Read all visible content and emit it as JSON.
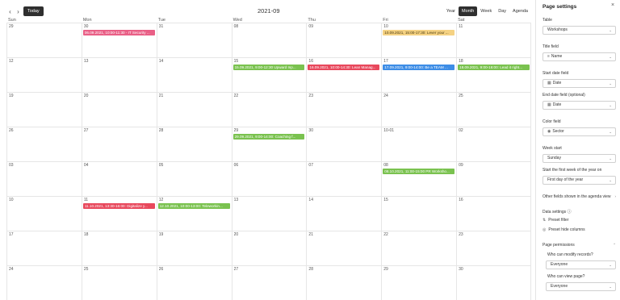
{
  "calendar": {
    "nav_prev": "‹",
    "nav_next": "›",
    "today_label": "Today",
    "month_title": "2021-09",
    "views": [
      "Year",
      "Month",
      "Week",
      "Day",
      "Agenda"
    ],
    "active_view": "Month",
    "weekdays": [
      "Sun",
      "Mon",
      "Tue",
      "Wed",
      "Thu",
      "Fri",
      "Sat"
    ],
    "weeks": [
      [
        "29",
        "30",
        "31",
        "08",
        "09",
        "10",
        "11"
      ],
      [
        "12",
        "13",
        "14",
        "15",
        "16",
        "17",
        "18"
      ],
      [
        "19",
        "20",
        "21",
        "22",
        "23",
        "24",
        "25"
      ],
      [
        "26",
        "27",
        "28",
        "29",
        "30",
        "10-01",
        "02"
      ],
      [
        "03",
        "04",
        "05",
        "06",
        "07",
        "08",
        "09"
      ],
      [
        "10",
        "11",
        "12",
        "13",
        "14",
        "15",
        "16"
      ],
      [
        "17",
        "18",
        "19",
        "20",
        "21",
        "22",
        "23"
      ],
      [
        "24",
        "25",
        "26",
        "27",
        "28",
        "29",
        "30"
      ]
    ],
    "events": [
      {
        "text": "06.09.2021, 10:00-11:30 - IT Security ...",
        "color": "pink",
        "week": 0,
        "day": 1,
        "span": 1
      },
      {
        "text": "10.09.2021, 15:00-17:30: Lever your ...",
        "color": "yellow",
        "week": 0,
        "day": 5,
        "span": 1
      },
      {
        "text": "15.09.2021, 9:00-12:30 Upward Inp...",
        "color": "green",
        "week": 1,
        "day": 3,
        "span": 1
      },
      {
        "text": "16.09.2021, 10:00-14:30: Lean Manag...",
        "color": "red",
        "week": 1,
        "day": 4,
        "span": 1
      },
      {
        "text": "17.09.2021, 9:00-14:00: Be a TEAM ...",
        "color": "blue",
        "week": 1,
        "day": 5,
        "span": 1
      },
      {
        "text": "18.09.2021, 9:00-16:00: Lead it right...",
        "color": "green",
        "week": 1,
        "day": 6,
        "span": 1
      },
      {
        "text": "29.09.2021, 9:00-14:00: Coaching f...",
        "color": "green",
        "week": 3,
        "day": 3,
        "span": 1
      },
      {
        "text": "08.10.2021, 11:00-15:00 PR Worksho...",
        "color": "green",
        "week": 4,
        "day": 5,
        "span": 1
      },
      {
        "text": "11.10.2021, 13:30-16:00: Digitalize y...",
        "color": "red",
        "week": 5,
        "day": 1,
        "span": 1
      },
      {
        "text": "12.10.2021, 10:00-13:00: Teleworkin...",
        "color": "green",
        "week": 5,
        "day": 2,
        "span": 1
      }
    ]
  },
  "settings": {
    "title": "Page settings",
    "close_icon": "×",
    "table_label": "Table",
    "table_value": "Workshops",
    "title_field_label": "Title field",
    "title_field_value": "Name",
    "start_date_label": "Start date field",
    "start_date_value": "Date",
    "end_date_label": "End date field (optional)",
    "end_date_value": "Date",
    "color_field_label": "Color field",
    "color_field_value": "Sector",
    "week_start_label": "Week start",
    "week_start_value": "Sunday",
    "first_week_label": "Start the first week of the year on",
    "first_week_value": "First day of the year",
    "other_fields_label": "Other fields shown in the agenda view",
    "data_settings_label": "Data settings",
    "info_icon": "ⓘ",
    "preset_filter_label": "Preset filter",
    "preset_hide_label": "Preset hide columns",
    "permissions_label": "Page permissions",
    "modify_label": "Who can modify records?",
    "modify_value": "Everyone",
    "view_label": "Who can view page?",
    "view_value": "Everyone"
  },
  "colors": {
    "pink": "#e95f86",
    "red": "#e8485c",
    "green": "#7ac24f",
    "blue": "#3d8de6",
    "yellow": "#f5d283"
  }
}
